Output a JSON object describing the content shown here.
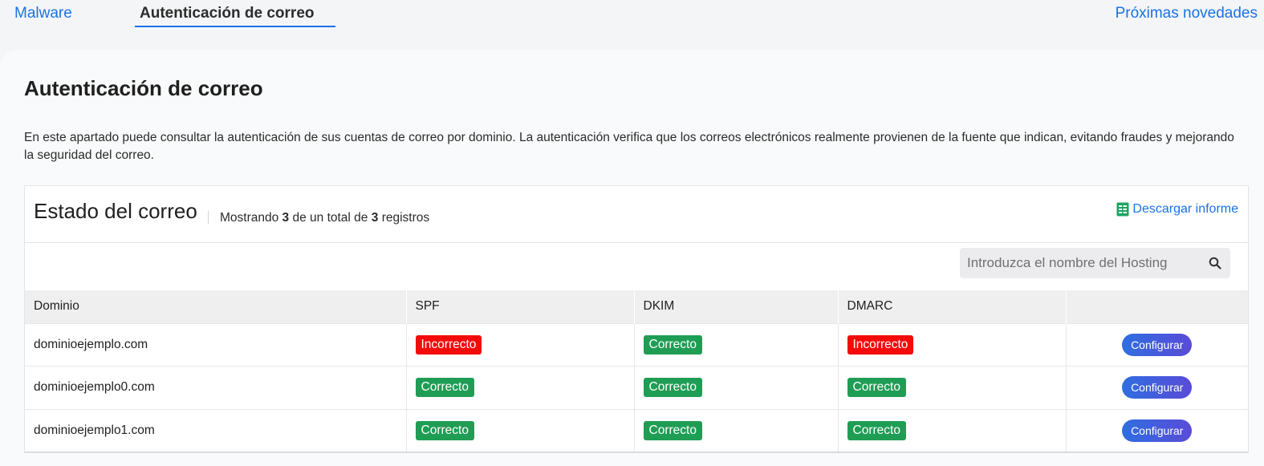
{
  "tabs": {
    "malware": "Malware",
    "auth": "Autenticación de correo",
    "next": "Próximas novedades"
  },
  "page": {
    "title": "Autenticación de correo",
    "description": "En este apartado puede consultar la autenticación de sus cuentas de correo por dominio. La autenticación verifica que los correos electrónicos realmente provienen de la fuente que indican, evitando fraudes y mejorando la seguridad del correo."
  },
  "card": {
    "title": "Estado del correo",
    "count_prefix": "Mostrando",
    "count_shown": "3",
    "count_middle": "de un total de",
    "count_total": "3",
    "count_suffix": "registros",
    "download_label": "Descargar informe",
    "download_icon": "spreadsheet-icon",
    "download_icon_color": "#1fa463"
  },
  "search": {
    "placeholder": "Introduzca el nombre del Hosting",
    "icon": "search-icon"
  },
  "table": {
    "headers": [
      "Dominio",
      "SPF",
      "DKIM",
      "DMARC",
      ""
    ],
    "rows": [
      {
        "domain": "dominioejemplo.com",
        "spf": "Incorrecto",
        "dkim": "Correcto",
        "dmarc": "Incorrecto",
        "action": "Configurar"
      },
      {
        "domain": "dominioejemplo0.com",
        "spf": "Correcto",
        "dkim": "Correcto",
        "dmarc": "Correcto",
        "action": "Configurar"
      },
      {
        "domain": "dominioejemplo1.com",
        "spf": "Correcto",
        "dkim": "Correcto",
        "dmarc": "Correcto",
        "action": "Configurar"
      }
    ]
  },
  "colors": {
    "accent": "#1a73e8",
    "ok": "#1f9d55",
    "bad": "#f50a0a"
  }
}
